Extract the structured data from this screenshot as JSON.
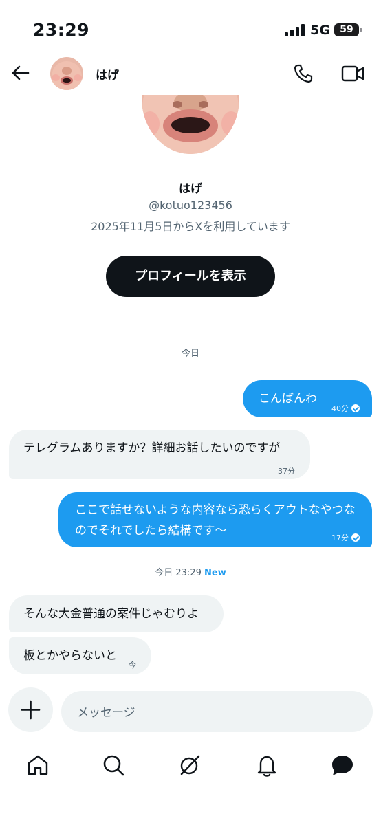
{
  "status_bar": {
    "time": "23:29",
    "network": "5G",
    "battery": "59"
  },
  "header": {
    "name": "はげ"
  },
  "profile": {
    "name": "はげ",
    "handle": "@kotuo123456",
    "joined": "2025年11月5日からXを利用しています",
    "view_profile_label": "プロフィールを表示"
  },
  "conversation": {
    "date_separator": "今日",
    "new_separator": {
      "label": "今日 23:29",
      "new_tag": "New"
    },
    "messages": [
      {
        "direction": "sent",
        "text": "こんばんわ",
        "time": "40分",
        "read": true
      },
      {
        "direction": "received",
        "text": "テレグラムありますか？詳細お話したいのですが",
        "time": "37分"
      },
      {
        "direction": "sent",
        "text": "ここで話せないような内容なら恐らくアウトなやつなのでそれでしたら結構です〜",
        "time": "17分",
        "read": true
      },
      {
        "direction": "received",
        "text": "そんな大金普通の案件じゃむりよ",
        "time": ""
      },
      {
        "direction": "received",
        "text": "板とかやらないと",
        "time": "今"
      }
    ]
  },
  "composer": {
    "placeholder": "メッセージ"
  },
  "bottom_nav": {
    "items": [
      {
        "icon": "home-icon"
      },
      {
        "icon": "search-icon"
      },
      {
        "icon": "grok-icon"
      },
      {
        "icon": "bell-icon"
      },
      {
        "icon": "messages-icon"
      }
    ]
  },
  "colors": {
    "accent": "#1d9bf0",
    "received_bubble": "#eff3f4",
    "dark_button": "#0f1419"
  }
}
